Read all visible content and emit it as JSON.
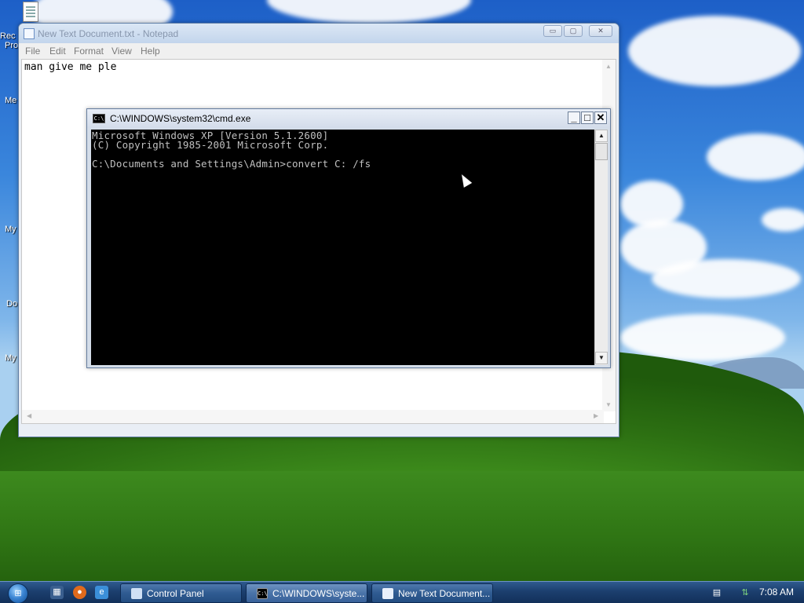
{
  "desktop": {
    "icon_labels": [
      "Rec",
      "Pro",
      "Me",
      "My",
      "Do",
      "My"
    ]
  },
  "notepad": {
    "title": "New Text Document.txt - Notepad",
    "menu": [
      "File",
      "Edit",
      "Format",
      "View",
      "Help"
    ],
    "content": "man give me ple",
    "controls": {
      "minimize": "▭",
      "maximize": "▢",
      "close": "✕"
    }
  },
  "cmd": {
    "title": "C:\\WINDOWS\\system32\\cmd.exe",
    "icon_text": "C:\\",
    "lines": [
      "Microsoft Windows XP [Version 5.1.2600]",
      "(C) Copyright 1985-2001 Microsoft Corp.",
      "",
      "C:\\Documents and Settings\\Admin>convert C: /fs"
    ],
    "controls": {
      "minimize": "_",
      "maximize": "□",
      "close": "✕"
    },
    "scroll_up": "▲",
    "scroll_down": "▼"
  },
  "taskbar": {
    "start_label": "⊞",
    "quicklaunch": [
      "show-desktop",
      "firefox",
      "internet-explorer"
    ],
    "buttons": [
      {
        "label": "Control Panel",
        "icon": "control-panel-icon"
      },
      {
        "label": "C:\\WINDOWS\\syste...",
        "icon": "cmd-icon"
      },
      {
        "label": "New Text Document...",
        "icon": "notepad-icon"
      }
    ],
    "clock": "7:08 AM"
  }
}
